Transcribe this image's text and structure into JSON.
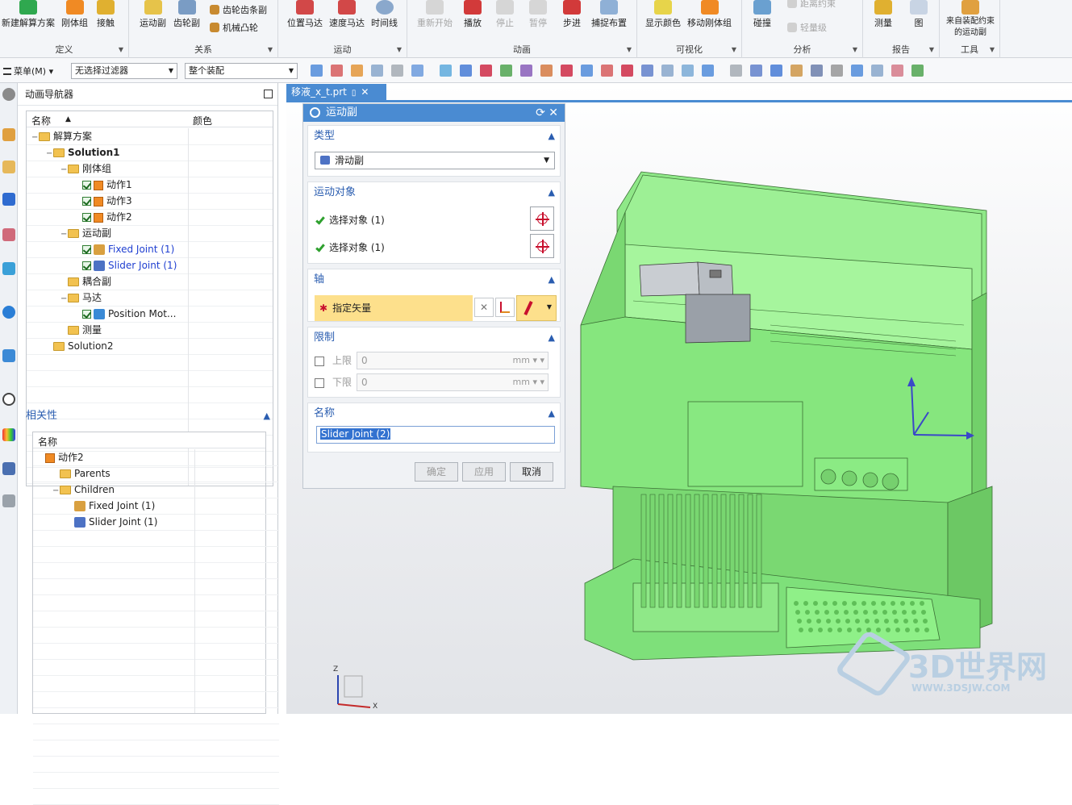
{
  "ribbon": {
    "define": {
      "label": "定义",
      "buttons": [
        "新建解算方案",
        "刚体组",
        "接触"
      ]
    },
    "relations": {
      "label": "关系",
      "buttons": [
        "运动副",
        "齿轮副"
      ],
      "small": [
        "齿轮齿条副",
        "机械凸轮"
      ]
    },
    "motion": {
      "label": "运动",
      "buttons": [
        "位置马达",
        "速度马达",
        "时间线"
      ]
    },
    "animation": {
      "label": "动画",
      "buttons": [
        "重新开始",
        "播放",
        "停止",
        "暂停",
        "步进",
        "捕捉布置"
      ]
    },
    "visualize": {
      "label": "可视化",
      "buttons": [
        "显示颜色",
        "移动刚体组"
      ]
    },
    "analysis": {
      "label": "分析",
      "buttons": [
        "碰撞"
      ],
      "small": [
        "距离约束",
        "轻量级"
      ]
    },
    "report": {
      "label": "报告",
      "buttons": [
        "测量",
        "图"
      ]
    },
    "tools": {
      "label": "工具",
      "buttons": [
        "来自装配约束的运动副"
      ]
    }
  },
  "toolbar": {
    "menu": "菜单(M)",
    "filter": "无选择过滤器",
    "scope": "整个装配"
  },
  "navigator": {
    "title": "动画导航器",
    "col_name": "名称",
    "col_color": "颜色",
    "tree": [
      {
        "label": "解算方案",
        "level": 0,
        "icon": "folder"
      },
      {
        "label": "Solution1",
        "level": 1,
        "icon": "folder",
        "bold": true
      },
      {
        "label": "刚体组",
        "level": 2,
        "icon": "folder"
      },
      {
        "label": "动作1",
        "level": 3,
        "icon": "cube",
        "check": true
      },
      {
        "label": "动作3",
        "level": 3,
        "icon": "cube",
        "check": true
      },
      {
        "label": "动作2",
        "level": 3,
        "icon": "cube",
        "check": true
      },
      {
        "label": "运动副",
        "level": 2,
        "icon": "folder"
      },
      {
        "label": "Fixed Joint (1)",
        "level": 3,
        "icon": "fixed-joint",
        "check": true,
        "blue": true
      },
      {
        "label": "Slider Joint (1)",
        "level": 3,
        "icon": "slider-joint",
        "check": true,
        "blue": true
      },
      {
        "label": "耦合副",
        "level": 2,
        "icon": "folder"
      },
      {
        "label": "马达",
        "level": 2,
        "icon": "folder"
      },
      {
        "label": "Position Mot...",
        "level": 3,
        "icon": "motor",
        "check": true
      },
      {
        "label": "测量",
        "level": 2,
        "icon": "folder"
      },
      {
        "label": "Solution2",
        "level": 1,
        "icon": "folder"
      }
    ]
  },
  "relations": {
    "title": "相关性",
    "col_name": "名称",
    "tree": [
      {
        "label": "动作2",
        "level": 0,
        "icon": "cube"
      },
      {
        "label": "Parents",
        "level": 1,
        "icon": "folder"
      },
      {
        "label": "Children",
        "level": 1,
        "icon": "folder"
      },
      {
        "label": "Fixed Joint (1)",
        "level": 2,
        "icon": "fixed-joint"
      },
      {
        "label": "Slider Joint (1)",
        "level": 2,
        "icon": "slider-joint"
      }
    ]
  },
  "tab": {
    "label": "移液_x_t.prt"
  },
  "dialog": {
    "title": "运动副",
    "type": {
      "header": "类型",
      "value": "滑动副"
    },
    "objects": {
      "header": "运动对象",
      "rows": [
        "选择对象 (1)",
        "选择对象 (1)"
      ]
    },
    "axis": {
      "header": "轴",
      "vector": "指定矢量"
    },
    "limits": {
      "header": "限制",
      "upper": "上限",
      "lower": "下限",
      "upper_value": "0",
      "lower_value": "0",
      "unit": "mm"
    },
    "name": {
      "header": "名称",
      "value": "Slider Joint (2)"
    },
    "buttons": {
      "ok": "确定",
      "apply": "应用",
      "cancel": "取消"
    }
  },
  "viewport": {
    "triad": {
      "x": "X",
      "z": "Z"
    },
    "watermark": "3D世界网",
    "watermark_sub": "WWW.3DSJW.COM"
  },
  "colors": {
    "accent": "#4a8bd2",
    "model_green": "#7ee07a",
    "highlight": "#fde08c"
  }
}
